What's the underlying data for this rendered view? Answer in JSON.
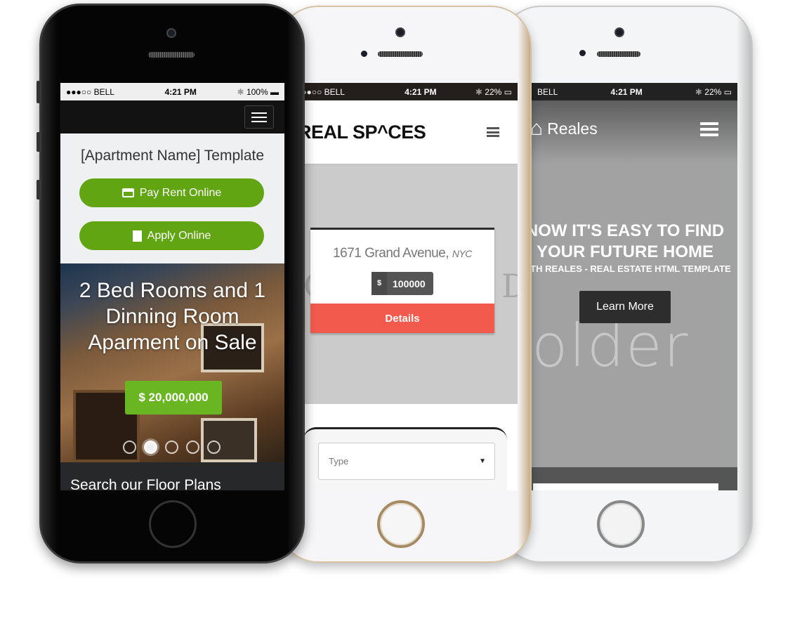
{
  "status": {
    "carrier_left": "●●●○○ BELL",
    "carrier": "BELL",
    "time": "4:21 PM",
    "battery_full": "100%",
    "battery_low": "22%"
  },
  "phone1": {
    "title": "[Apartment Name] Template",
    "pay_label": "Pay Rent Online",
    "apply_label": "Apply Online",
    "hero_line1": "2 Bed Rooms and 1",
    "hero_line2": "Dinning Room",
    "hero_line3": "Aparment on Sale",
    "price": "$ 20,000,000",
    "slides": 5,
    "active_slide": 2,
    "search_heading": "Search our Floor Plans",
    "accent": "#62a513"
  },
  "phone2": {
    "logo": "REAL SP^CES",
    "bg_text_left": "C",
    "bg_text_right": "DE",
    "address": "1671 Grand Avenue,",
    "city": "NYC",
    "currency": "$",
    "price": "100000",
    "details_label": "Details",
    "type_placeholder": "Type",
    "accent": "#f25a4d"
  },
  "phone3": {
    "logo": "Reales",
    "headline1": "NOW IT'S EASY TO FIND",
    "headline2": "YOUR FUTURE HOME",
    "subline": "WITH REALES - REAL ESTATE HTML TEMPLATE",
    "button_label": "Learn More",
    "bg_text": "older"
  }
}
